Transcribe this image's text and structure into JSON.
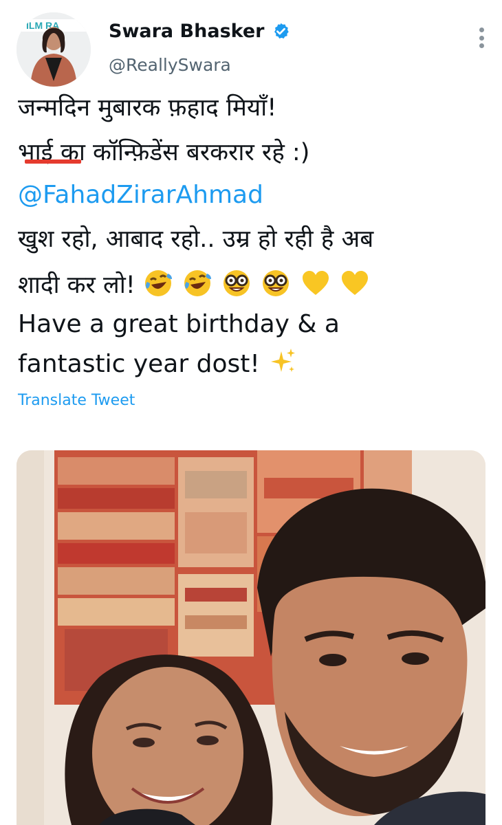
{
  "author": {
    "name": "Swara Bhasker",
    "handle": "@ReallySwara",
    "avatar_banner_text": "ILM RA"
  },
  "tweet": {
    "line1": "जन्मदिन मुबारक फ़हाद मियाँ!",
    "line2": "भाई का कॉन्फ़िडेंस बरकरार रहे :)",
    "mention": "@FahadZirarAhmad",
    "line4": "खुश रहो, आबाद रहो..  उम्र हो रही है अब",
    "line5": "शादी कर लो!",
    "line5_emojis": [
      "rolling-laughing-emoji",
      "rolling-laughing-emoji",
      "nerd-face-emoji",
      "nerd-face-emoji",
      "yellow-heart-emoji",
      "yellow-heart-emoji"
    ],
    "line6": "Have a great birthday & a",
    "line7": "fantastic year dost!",
    "line7_emoji": "sparkles-emoji"
  },
  "translate_label": "Translate Tweet",
  "colors": {
    "link": "#1d9bf0",
    "verified": "#1d9bf0",
    "underline": "#e53b2e",
    "text": "#0f1419",
    "muted": "#536471"
  }
}
